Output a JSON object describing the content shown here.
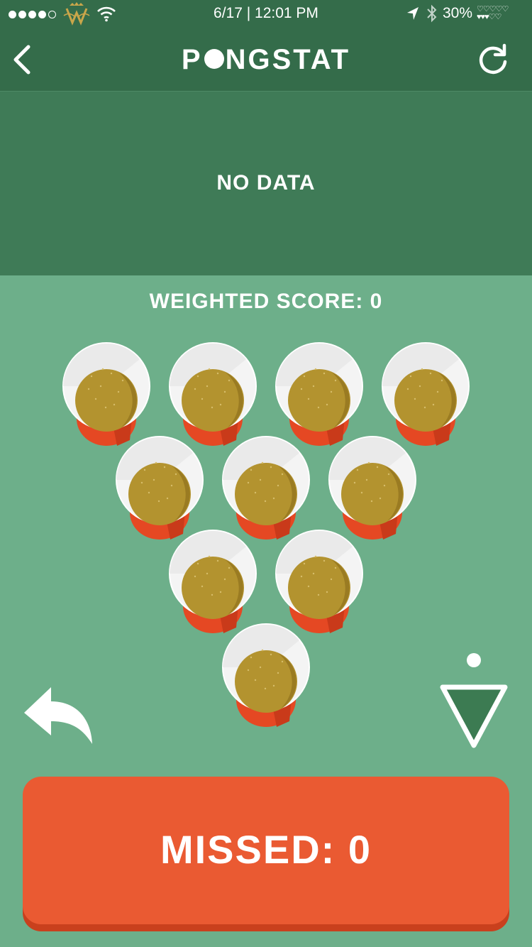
{
  "status_bar": {
    "time": "6/17 | 12:01 PM",
    "battery": "30%",
    "signal_bars": 4,
    "signal_total": 5
  },
  "header": {
    "title_before_o": "P",
    "title_after_o": "NGSTAT",
    "back_icon": "chevron-left-icon",
    "refresh_icon": "refresh-icon"
  },
  "stats_panel": {
    "message": "NO DATA"
  },
  "score": {
    "label": "WEIGHTED SCORE: 0"
  },
  "cups": {
    "rows": [
      4,
      3,
      2,
      1
    ],
    "colors": {
      "cup_red": "#e54823",
      "rim": "#f4f4f4",
      "beer": "#b3932f"
    }
  },
  "controls": {
    "undo_icon": "undo-arrow-icon",
    "triangle_icon": "triangle-down-icon"
  },
  "missed_button": {
    "label": "MISSED: 0"
  },
  "colors": {
    "header_bg": "#346c4a",
    "panel_bg": "#3f7b57",
    "table_bg": "#6daf8a",
    "missed_bg": "#ea5a32"
  }
}
